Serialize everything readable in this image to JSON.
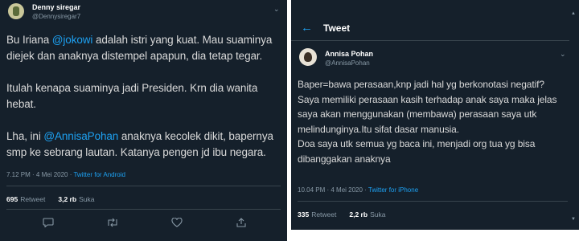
{
  "left_tweet": {
    "author_name": "Denny siregar",
    "author_handle": "@Dennysiregar7",
    "p1_a": "Bu Iriana ",
    "p1_mention": "@jokowi",
    "p1_b": " adalah istri yang kuat. Mau suaminya diejek dan anaknya distempel apapun, dia tetap tegar.",
    "p2": "Itulah kenapa suaminya jadi Presiden. Krn dia wanita hebat.",
    "p3_a": "Lha, ini ",
    "p3_mention": "@AnnisaPohan",
    "p3_b": " anaknya kecolek dikit, bapernya smp ke sebrang lautan. Katanya pengen jd ibu negara.",
    "timestamp": "7.12 PM · 4 Mei 2020 · ",
    "source": "Twitter for Android",
    "retweets": "695",
    "retweet_label": "Retweet",
    "likes": "3,2 rb",
    "likes_label": "Suka"
  },
  "right_panel": {
    "header_title": "Tweet",
    "author_name": "Annisa Pohan",
    "author_handle": "@AnnisaPohan",
    "body": "Baper=bawa perasaan,knp jadi hal yg berkonotasi negatif? Saya memiliki perasaan kasih terhadap anak saya maka jelas saya akan menggunakan (membawa) perasaan saya utk melindunginya.Itu sifat dasar manusia.\nDoa saya utk semua yg baca ini, menjadi org tua yg bisa dibanggakan anaknya",
    "timestamp": "10.04 PM · 4 Mei 2020 · ",
    "source": "Twitter for iPhone",
    "retweets": "335",
    "retweet_label": "Retweet",
    "likes": "2,2 rb",
    "likes_label": "Suka"
  },
  "icons": [
    "chevron-down-icon",
    "back-arrow-icon",
    "reply-icon",
    "retweet-icon",
    "like-icon",
    "share-icon",
    "scroll-up-icon",
    "scroll-down-icon"
  ],
  "colors": {
    "background": "#15202b",
    "text": "#d9d9d9",
    "link": "#1da1f2",
    "muted": "#8899a6",
    "divider": "#38444d"
  }
}
